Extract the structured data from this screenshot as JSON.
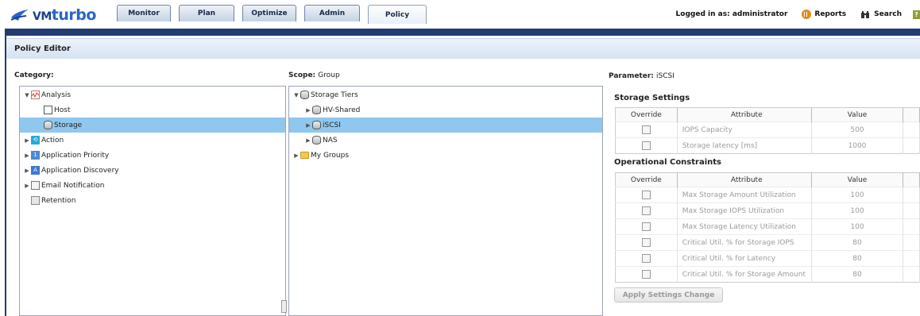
{
  "app": {
    "logo_vm": "VM",
    "logo_turbo": "turbo"
  },
  "nav": {
    "tabs": [
      {
        "label": "Monitor"
      },
      {
        "label": "Plan"
      },
      {
        "label": "Optimize"
      },
      {
        "label": "Admin"
      },
      {
        "label": "Policy"
      }
    ],
    "active_tab": "Policy",
    "logged_in": "Logged in as: administrator",
    "reports": "Reports",
    "search": "Search",
    "help": "?"
  },
  "page": {
    "title": "Policy Editor"
  },
  "category": {
    "label": "Category:",
    "items": [
      {
        "label": "Analysis",
        "icon": "analysis-icon",
        "expanded": true
      },
      {
        "label": "Host",
        "icon": "host-icon"
      },
      {
        "label": "Storage",
        "icon": "storage-icon",
        "selected": true
      },
      {
        "label": "Action",
        "icon": "action-icon"
      },
      {
        "label": "Application Priority",
        "icon": "application-priority-icon"
      },
      {
        "label": "Application Discovery",
        "icon": "application-discovery-icon"
      },
      {
        "label": "Email Notification",
        "icon": "email-icon"
      },
      {
        "label": "Retention",
        "icon": "retention-icon"
      }
    ]
  },
  "scope": {
    "label": "Scope:",
    "value": "Group",
    "items": [
      {
        "label": "Storage Tiers",
        "icon": "storage-icon",
        "expanded": true
      },
      {
        "label": "HV-Shared",
        "icon": "storage-icon"
      },
      {
        "label": "iSCSI",
        "icon": "storage-icon",
        "selected": true
      },
      {
        "label": "NAS",
        "icon": "storage-icon"
      },
      {
        "label": "My Groups",
        "icon": "folder-icon"
      }
    ]
  },
  "parameter": {
    "label": "Parameter:",
    "value": "iSCSI"
  },
  "storage_settings": {
    "title": "Storage Settings",
    "headers": [
      "Override",
      "Attribute",
      "Value"
    ],
    "rows": [
      {
        "attribute": "IOPS Capacity",
        "value": "500"
      },
      {
        "attribute": "Storage latency [ms]",
        "value": "1000"
      }
    ]
  },
  "operational_constraints": {
    "title": "Operational Constraints",
    "headers": [
      "Override",
      "Attribute",
      "Value"
    ],
    "rows": [
      {
        "attribute": "Max Storage Amount Utilization",
        "value": "100"
      },
      {
        "attribute": "Max Storage IOPS Utilization",
        "value": "100"
      },
      {
        "attribute": "Max Storage Latency Utilization",
        "value": "100"
      },
      {
        "attribute": "Critical Util. % for Storage IOPS",
        "value": "80"
      },
      {
        "attribute": "Critical Util. % for Latency",
        "value": "80"
      },
      {
        "attribute": "Critical Util. % for Storage Amount",
        "value": "80"
      }
    ]
  },
  "apply_button": "Apply Settings Change"
}
